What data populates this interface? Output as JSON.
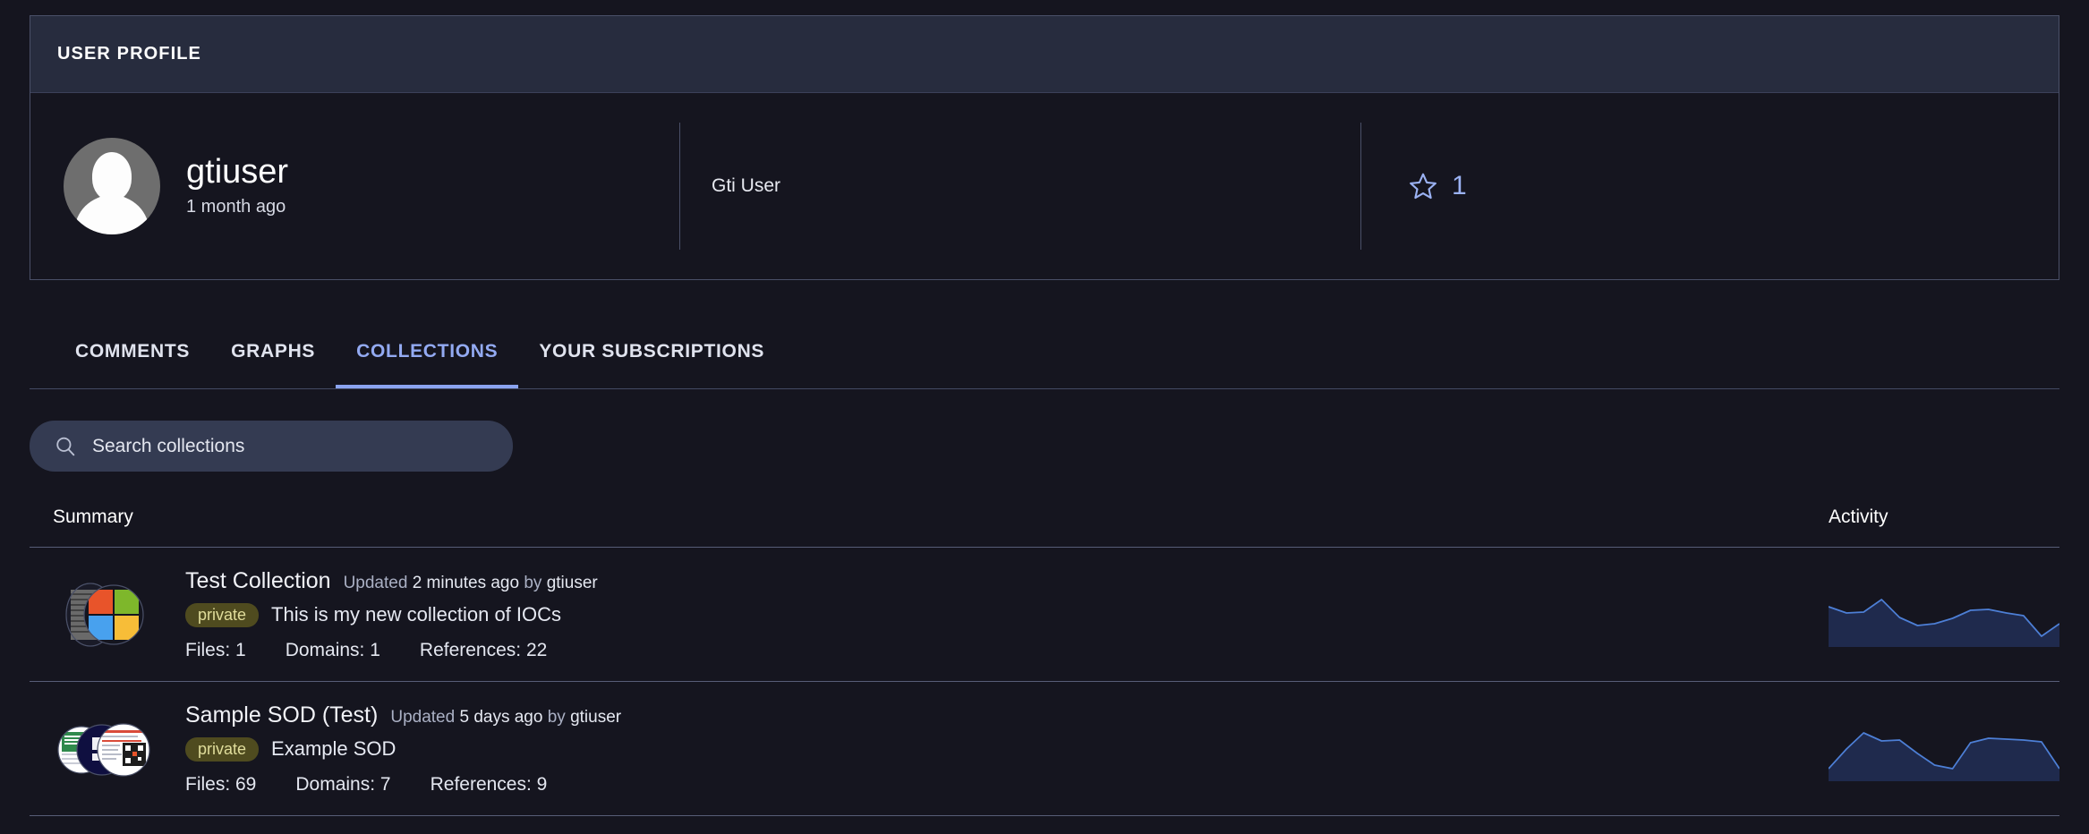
{
  "profile": {
    "card_title": "USER PROFILE",
    "avatar_icon": "default-user-avatar-icon",
    "username": "gtiuser",
    "joined": "1 month ago",
    "full_name": "Gti User",
    "reputation_icon": "star-icon",
    "reputation": "1"
  },
  "tabs": [
    {
      "label": "COMMENTS",
      "active": false
    },
    {
      "label": "GRAPHS",
      "active": false
    },
    {
      "label": "COLLECTIONS",
      "active": true
    },
    {
      "label": "YOUR SUBSCRIPTIONS",
      "active": false
    }
  ],
  "search": {
    "icon": "search-icon",
    "placeholder": "Search collections",
    "value": ""
  },
  "table": {
    "columns": {
      "summary": "Summary",
      "activity": "Activity"
    },
    "rows": [
      {
        "thumbnail_icon": "microsoft-logo-collection-thumbnail",
        "name": "Test Collection",
        "updated_prefix": "Updated",
        "updated_when": "2 minutes ago",
        "updated_by_prefix": "by",
        "updated_by": "gtiuser",
        "visibility_badge": "private",
        "description": "This is my new collection of IOCs",
        "stats": [
          "Files: 1",
          "Domains: 1",
          "References: 22"
        ]
      },
      {
        "thumbnail_icon": "documents-stack-collection-thumbnail",
        "name": "Sample SOD (Test)",
        "updated_prefix": "Updated",
        "updated_when": "5 days ago",
        "updated_by_prefix": "by",
        "updated_by": "gtiuser",
        "visibility_badge": "private",
        "description": "Example SOD",
        "stats": [
          "Files: 69",
          "Domains: 7",
          "References: 9"
        ]
      }
    ]
  },
  "chart_data": [
    {
      "type": "area",
      "title": "Activity sparkline - Test Collection",
      "x": [
        0,
        1,
        2,
        3,
        4,
        5,
        6,
        7,
        8,
        9,
        10,
        11,
        12,
        13
      ],
      "values": [
        62,
        52,
        53,
        72,
        46,
        32,
        34,
        44,
        57,
        58,
        53,
        49,
        17,
        34
      ],
      "xlabel": "",
      "ylabel": "",
      "ylim": [
        0,
        100
      ],
      "grid": false,
      "legend": false,
      "line_color": "#4d7fd6",
      "fill_color": "#1f2a4d"
    },
    {
      "type": "area",
      "title": "Activity sparkline - Sample SOD (Test)",
      "x": [
        0,
        1,
        2,
        3,
        4,
        5,
        6,
        7,
        8,
        9,
        10,
        11,
        12,
        13
      ],
      "values": [
        18,
        48,
        72,
        60,
        60,
        43,
        28,
        22,
        20,
        50,
        58,
        57,
        56,
        18
      ],
      "xlabel": "",
      "ylabel": "",
      "ylim": [
        0,
        100
      ],
      "grid": false,
      "legend": false,
      "line_color": "#4d7fd6",
      "fill_color": "#1f2a4d"
    }
  ]
}
